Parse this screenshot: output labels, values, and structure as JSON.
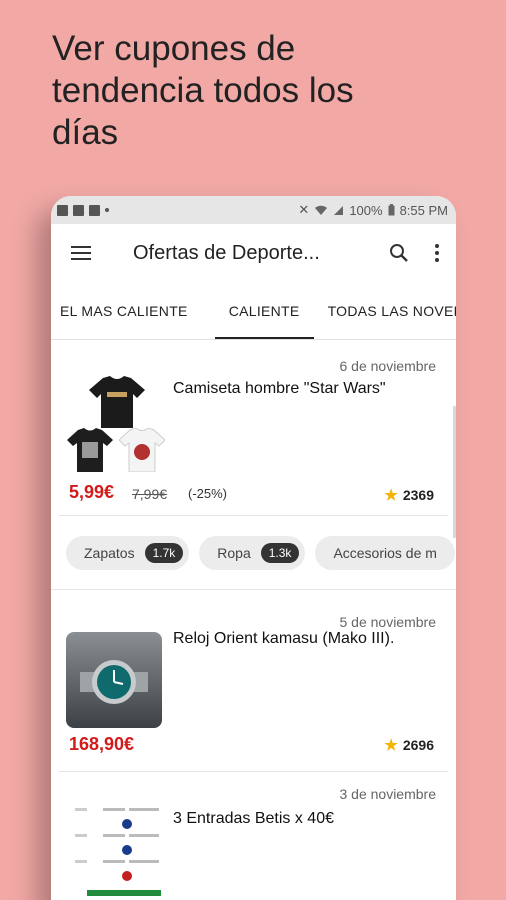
{
  "promo": {
    "lines": [
      "Ver cupones de",
      "tendencia todos los",
      "días"
    ]
  },
  "status_bar": {
    "battery": "100%",
    "time": "8:55 PM"
  },
  "app_bar": {
    "title": "Ofertas de Deporte..."
  },
  "tabs": [
    "EL MAS CALIENTE",
    "CALIENTE",
    "TODAS LAS NOVEDADES"
  ],
  "deals": [
    {
      "date": "6 de noviembre",
      "title": "Camiseta hombre \"Star Wars\"",
      "price": "5,99€",
      "old_price": "7,99€",
      "discount": "(-25%)",
      "score": "2369"
    },
    {
      "date": "5 de noviembre",
      "title": "Reloj Orient kamasu (Mako III).",
      "price": "168,90€",
      "score": "2696"
    },
    {
      "date": "3 de noviembre",
      "title": "3 Entradas Betis x 40€"
    }
  ],
  "categories": [
    {
      "label": "Zapatos",
      "count": "1.7k"
    },
    {
      "label": "Ropa",
      "count": "1.3k"
    },
    {
      "label": "Accesorios de m"
    }
  ],
  "colors": {
    "background": "#f2a9a6",
    "price": "#d21b1b",
    "star": "#f4b400"
  }
}
